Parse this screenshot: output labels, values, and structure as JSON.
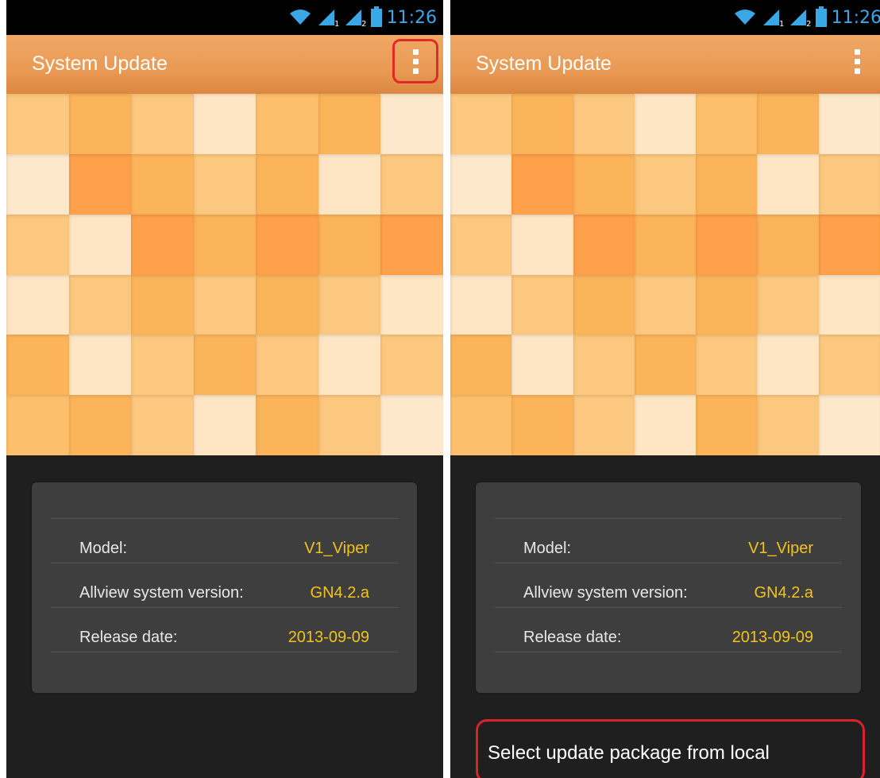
{
  "status_bar": {
    "time": "11:26"
  },
  "action_bar": {
    "title": "System Update",
    "overflow_icon": "overflow-menu-icon"
  },
  "device_info": {
    "rows": [
      {
        "label": "Model:",
        "value": "V1_Viper"
      },
      {
        "label": "Allview system version:",
        "value": "GN4.2.a"
      },
      {
        "label": "Release date:",
        "value": "2013-09-09"
      }
    ]
  },
  "menu": {
    "select_local_label": "Select update package from local"
  },
  "colors": {
    "action_bar": "#eb9e59",
    "highlight": "#e02b2b",
    "value_text": "#f2c21c",
    "status_time": "#3aa8e6",
    "card": "#3e3e3e"
  }
}
